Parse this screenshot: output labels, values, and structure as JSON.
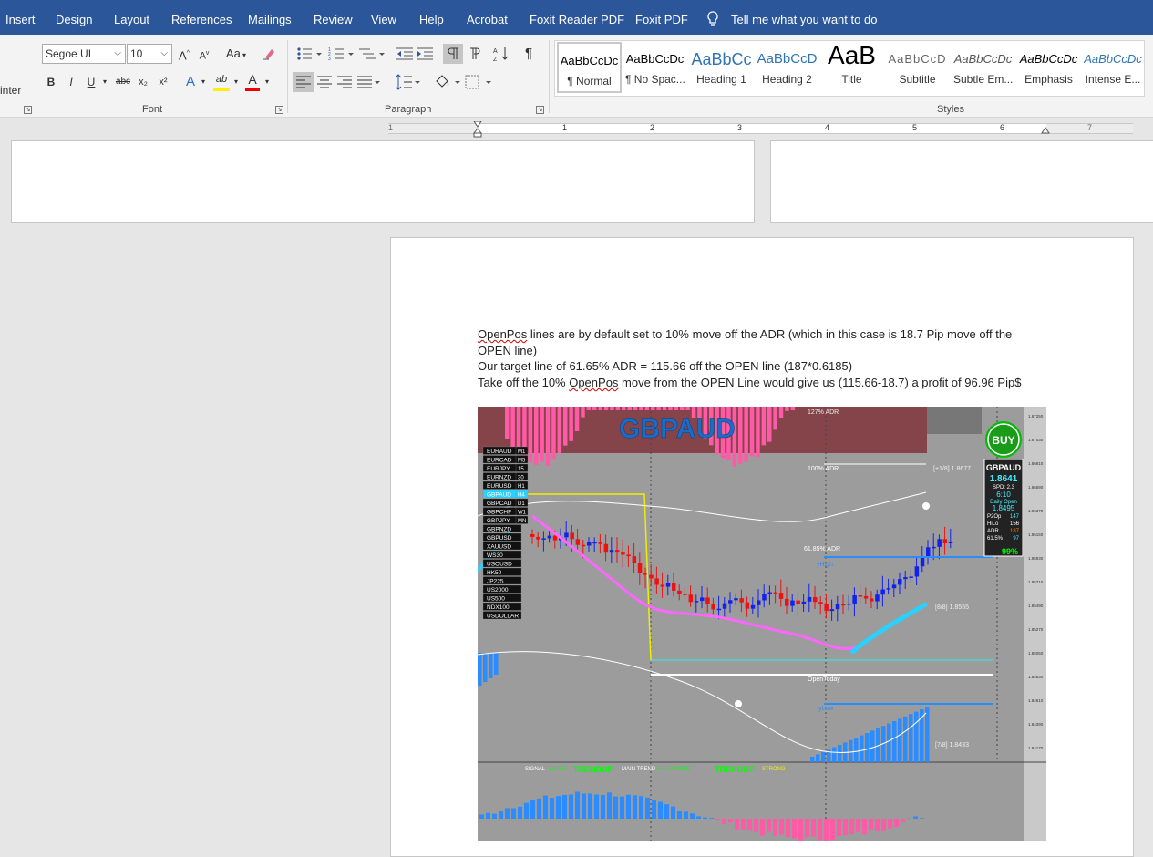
{
  "ribbon_tabs": [
    "Insert",
    "Design",
    "Layout",
    "References",
    "Mailings",
    "Review",
    "View",
    "Help",
    "Acrobat",
    "Foxit Reader PDF",
    "Foxit PDF"
  ],
  "tell_me": "Tell me what you want to do",
  "clipboard": {
    "partial_label": "inter"
  },
  "font": {
    "family": "Segoe UI",
    "size": "10",
    "group_label": "Font",
    "grow": "A",
    "shrink": "A",
    "change_case": "Aa",
    "bold": "B",
    "italic": "I",
    "underline": "U",
    "strike": "abc",
    "subscript": "x₂",
    "superscript": "x²",
    "text_effects": "A",
    "highlight": "ab",
    "font_color": "A"
  },
  "paragraph": {
    "group_label": "Paragraph",
    "pilcrow": "¶"
  },
  "styles": {
    "group_label": "Styles",
    "items": [
      {
        "sample": "AaBbCcDc",
        "name": "¶ Normal"
      },
      {
        "sample": "AaBbCcDc",
        "name": "¶ No Spac..."
      },
      {
        "sample": "AaBbCc",
        "name": "Heading 1"
      },
      {
        "sample": "AaBbCcD",
        "name": "Heading 2"
      },
      {
        "sample": "AaB",
        "name": "Title"
      },
      {
        "sample": "AaBbCcD",
        "name": "Subtitle"
      },
      {
        "sample": "AaBbCcDc",
        "name": "Subtle Em..."
      },
      {
        "sample": "AaBbCcDc",
        "name": "Emphasis"
      },
      {
        "sample": "AaBbCcDc",
        "name": "Intense E..."
      }
    ]
  },
  "ruler": {
    "numbers": [
      "1",
      "1",
      "2",
      "3",
      "4",
      "5",
      "6",
      "7"
    ]
  },
  "document": {
    "line1_a": "OpenPos",
    "line1_b": " lines are by default set to 10% move off the ADR (which in this case is 18.7 Pip move off the OPEN line)",
    "line2": "Our target line of 61.65% ADR = 115.66 off the OPEN line (187*0.6185)",
    "line3_a": "Take off the 10% ",
    "line3_b": "OpenPos",
    "line3_c": " move from the OPEN Line would give us (115.66-18.7) a profit of 96.96 Pip$"
  },
  "chart_image": {
    "symbol": "GBPAUD",
    "adr127": "127% ADR",
    "adr100": "100% ADR",
    "adr61": "61.85% ADR",
    "lvl_1_8": "[+1/8] 1.8677",
    "lvl_8_8": "[8/8] 1.8555",
    "lvl_7_8": "[7/8] 1.8433",
    "yhigh": "yHigh",
    "ylow": "yLow",
    "open_today": "OpenToday",
    "symbols": [
      [
        "EURAUD",
        "M1"
      ],
      [
        "EURCAD",
        "M5"
      ],
      [
        "EURJPY",
        "15"
      ],
      [
        "EURNZD",
        "30"
      ],
      [
        "EURUSD",
        "H1"
      ],
      [
        "GBPAUD",
        "H4"
      ],
      [
        "GBPCAD",
        "D1"
      ],
      [
        "GBPCHF",
        "W1"
      ],
      [
        "GBPJPY",
        "MN"
      ],
      [
        "GBPNZD",
        ""
      ],
      [
        "GBPUSD",
        ""
      ],
      [
        "XAUUSD",
        ""
      ],
      [
        "WS30",
        ""
      ],
      [
        "USOUSD",
        ""
      ],
      [
        "HK50",
        ""
      ],
      [
        "JP225",
        ""
      ],
      [
        "US2000",
        ""
      ],
      [
        "US500",
        ""
      ],
      [
        "NDX100",
        ""
      ],
      [
        "USDOLLAR",
        ""
      ]
    ],
    "buy": "BUY",
    "panel": {
      "sym": "GBPAUD",
      "price": "1.8641",
      "spd": "SPD: 2.3",
      "time": "6:10",
      "daily_open_label": "Daily Open",
      "daily_open": "1.8495",
      "rows": [
        [
          "P2Op",
          "147"
        ],
        [
          "HiLo",
          "156"
        ],
        [
          "ADR",
          "187"
        ],
        [
          "61.5%",
          "97"
        ]
      ],
      "pct": "99%"
    },
    "sub_signal": "SIGNAL",
    "sub_w": "W1 W1",
    "sub_trend": "TRENDUP",
    "sub_main": "MAIN TREND",
    "sub_frames": "H4 H4 H1 H4",
    "sub_trend2": "TRENDUP",
    "sub_strong": "STRONG",
    "axis": [
      "1.87250",
      "1.87030",
      "1.86810",
      "1.86590",
      "1.86370",
      "1.86150",
      "1.85930",
      "1.85710",
      "1.85490",
      "1.85270",
      "1.85050",
      "1.84830",
      "1.84610",
      "1.84390",
      "1.84170"
    ]
  }
}
